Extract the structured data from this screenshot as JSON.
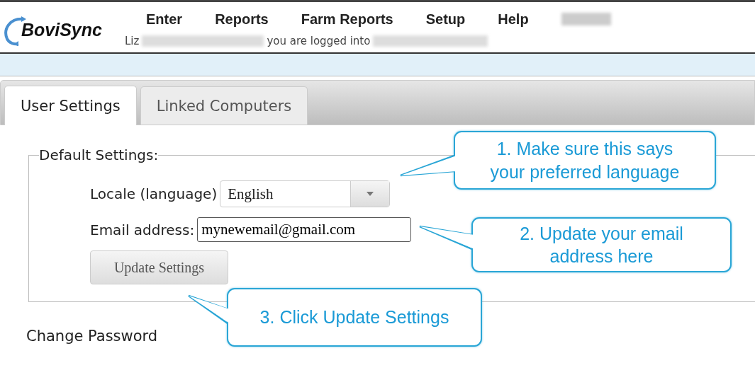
{
  "logo": {
    "text": "BoviSync"
  },
  "nav": {
    "menu": [
      {
        "label": "Enter"
      },
      {
        "label": "Reports"
      },
      {
        "label": "Farm Reports"
      },
      {
        "label": "Setup"
      },
      {
        "label": "Help"
      }
    ],
    "user_name": "Liz",
    "logged_into": "you are logged into"
  },
  "tabs": [
    {
      "label": "User Settings",
      "selected": true
    },
    {
      "label": "Linked Computers",
      "selected": false
    }
  ],
  "default_settings": {
    "legend": "Default Settings:",
    "locale": {
      "label": "Locale (language)",
      "value": "English"
    },
    "email": {
      "label": "Email address:",
      "value": "mynewemail@gmail.com"
    },
    "button": "Update Settings"
  },
  "change_password": "Change Password",
  "callouts": [
    "1. Make sure this says your preferred language",
    "2. Update your email address here",
    "3. Click Update Settings"
  ]
}
